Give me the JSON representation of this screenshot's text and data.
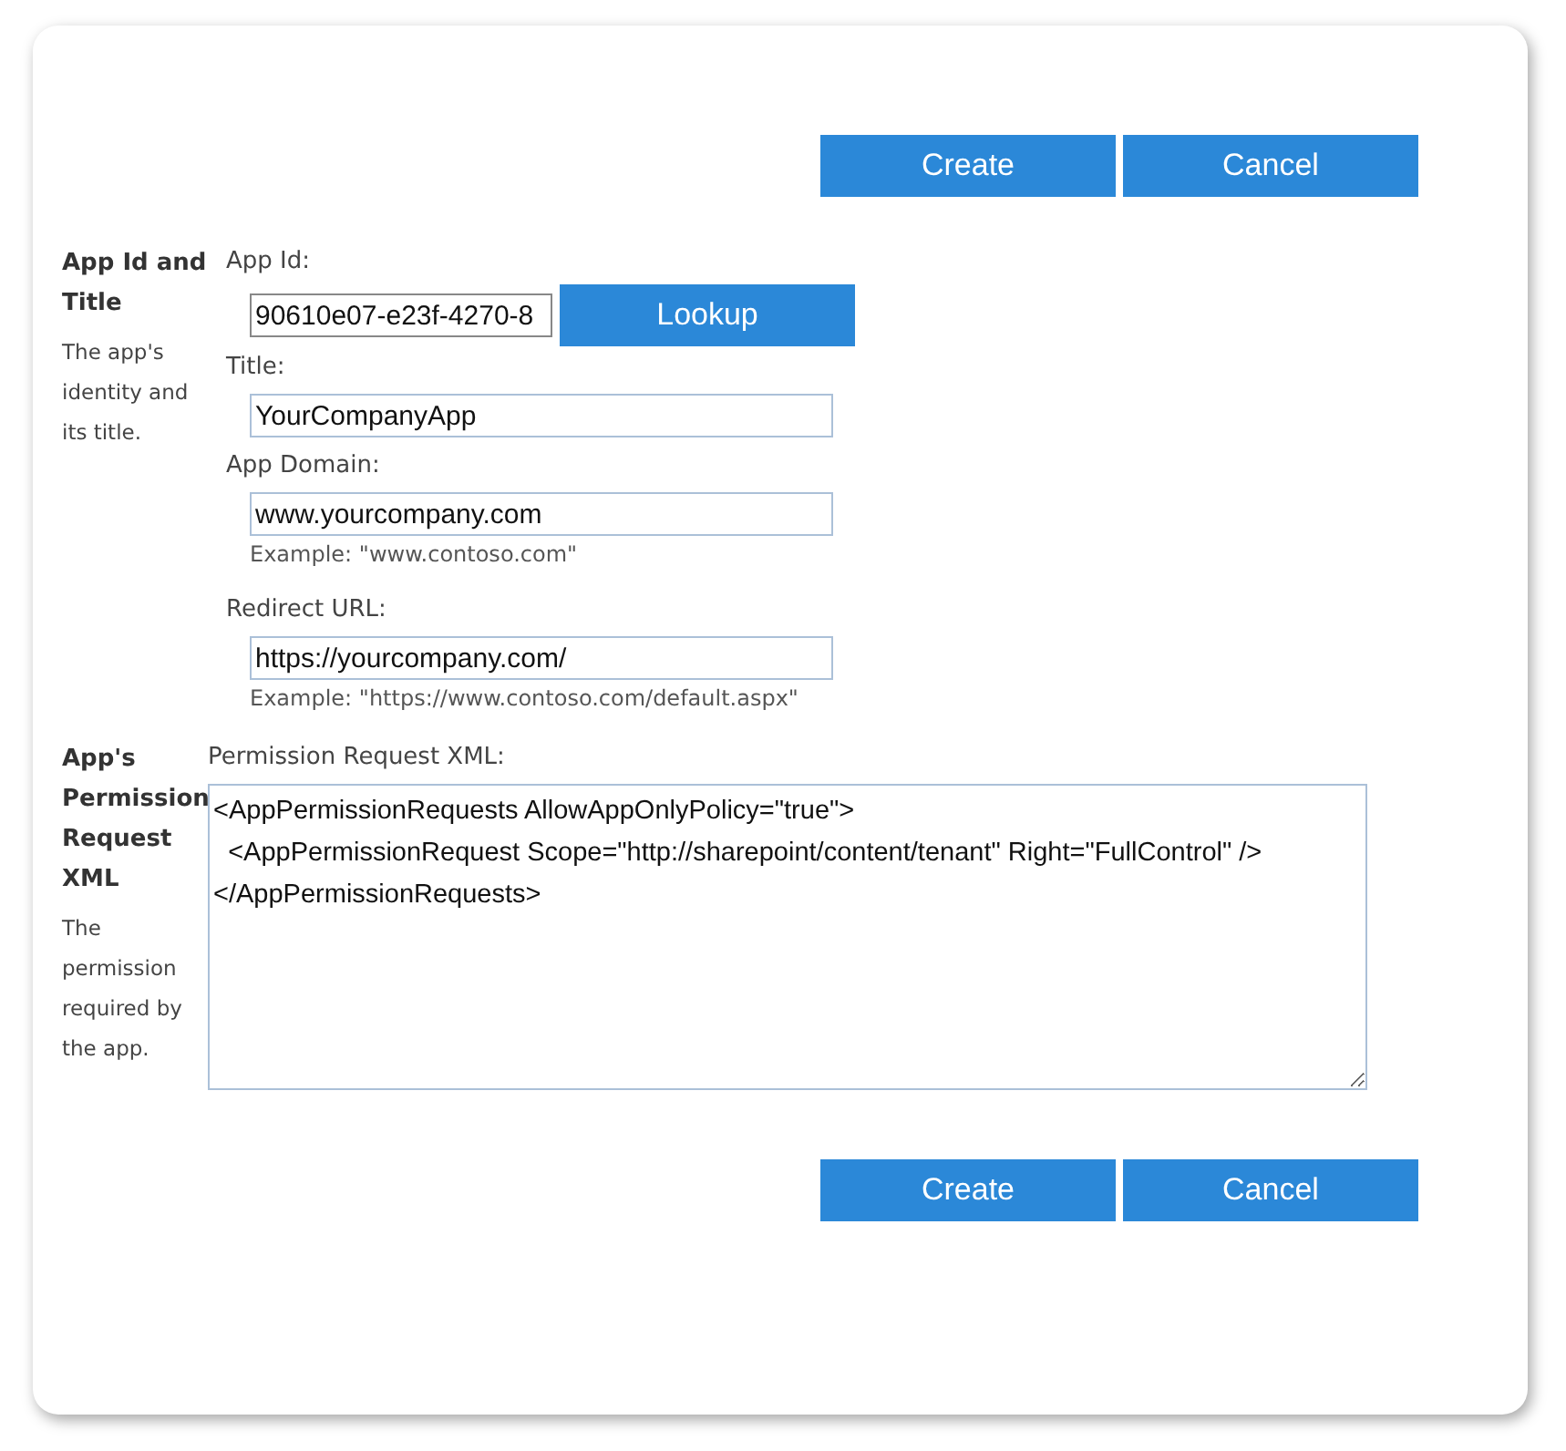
{
  "top_buttons": [
    "Create",
    "Cancel"
  ],
  "sections": [
    {
      "title": "App Id and Title",
      "description": "The app's identity and its title."
    },
    {
      "title": "App's Permission Request XML",
      "description": "The permission required by the app."
    }
  ],
  "app_id": {
    "label": "App Id:",
    "value": "90610e07-e23f-4270-8",
    "button": "Lookup"
  },
  "fields": [
    {
      "label": "Title:",
      "value": "YourCompanyApp"
    },
    {
      "label": "App Domain:",
      "value": "www.yourcompany.com",
      "example": "Example: \"www.contoso.com\""
    },
    {
      "label": "Redirect URL:",
      "value": "https://yourcompany.com/",
      "example": "Example: \"https://www.contoso.com/default.aspx\""
    }
  ],
  "xml": {
    "label": "Permission Request XML:",
    "lines": [
      "<AppPermissionRequests AllowAppOnlyPolicy=\"true\">",
      "  <AppPermissionRequest Scope=\"http://sharepoint/content/tenant\" Right=\"FullControl\" />",
      "</AppPermissionRequests>"
    ]
  },
  "bottom_buttons": [
    "Create",
    "Cancel"
  ]
}
